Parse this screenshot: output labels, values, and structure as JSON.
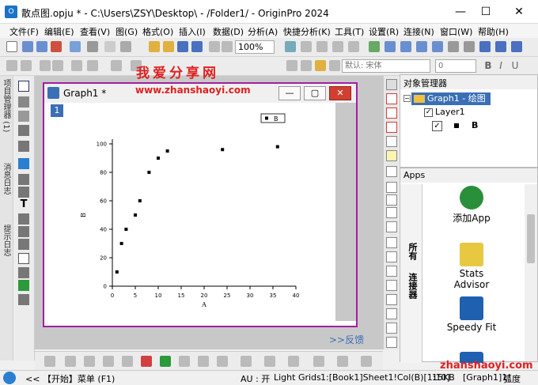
{
  "window": {
    "title": "散点图.opju * - C:\\Users\\ZSY\\Desktop\\ - /Folder1/ - OriginPro 2024",
    "minimize": "—",
    "maximize": "☐",
    "close": "✕"
  },
  "menu": [
    "文件(F)",
    "编辑(E)",
    "查看(V)",
    "图(G)",
    "格式(O)",
    "插入(I)",
    "数据(D)",
    "分析(A)",
    "快捷分析(K)",
    "工具(T)",
    "设置(R)",
    "连接(N)",
    "窗口(W)",
    "帮助(H)"
  ],
  "toolbar": {
    "zoom": "100%",
    "font": "默认: 宋体",
    "font_size": "0"
  },
  "left_tabs": [
    "项目管理器 (1)",
    "消息日志",
    "提示日志"
  ],
  "watermark": {
    "cn": "我爱分享网",
    "url": "www.zhanshaoyi.com"
  },
  "graph": {
    "window_title": "Graph1 *",
    "layer_badge": "1",
    "legend_label": "B",
    "chart_data": {
      "type": "scatter",
      "x": [
        1,
        2,
        3,
        5,
        6,
        8,
        10,
        12,
        24,
        36
      ],
      "y": [
        10,
        30,
        40,
        50,
        60,
        80,
        90,
        95,
        96,
        98
      ],
      "series": [
        {
          "name": "B"
        }
      ],
      "xlabel": "A",
      "ylabel": "B",
      "xlim": [
        0,
        40
      ],
      "ylim": [
        0,
        100
      ],
      "xticks": [
        "0",
        "5",
        "10",
        "15",
        "20",
        "25",
        "30",
        "35",
        "40"
      ],
      "yticks": [
        "0",
        "20",
        "40",
        "60",
        "80",
        "100"
      ]
    }
  },
  "feedback": ">>反馈",
  "object_manager": {
    "title": "对象管理器",
    "graph_node": "Graph1 - 绘图",
    "layer_node": "Layer1",
    "plot_node": "B"
  },
  "apps": {
    "title": "Apps",
    "tabs": [
      "所有",
      "连接器"
    ],
    "items": [
      {
        "label": "添加App",
        "color": "#2a8f3a"
      },
      {
        "label": "Stats\nAdvisor",
        "color": "#e8c840"
      },
      {
        "label": "Speedy Fit",
        "color": "#2060b0"
      }
    ]
  },
  "status": {
    "hint": "<< 【开始】菜单 (F1)",
    "au": "AU : 开",
    "grids": "Light Grids",
    "range": "1:[Book1]Sheet1!Col(B)[1:10]",
    "size": "15KB",
    "graph": "[Graph1]1!",
    "unit": "弧度",
    "site": "zhanshaoyi.com"
  }
}
